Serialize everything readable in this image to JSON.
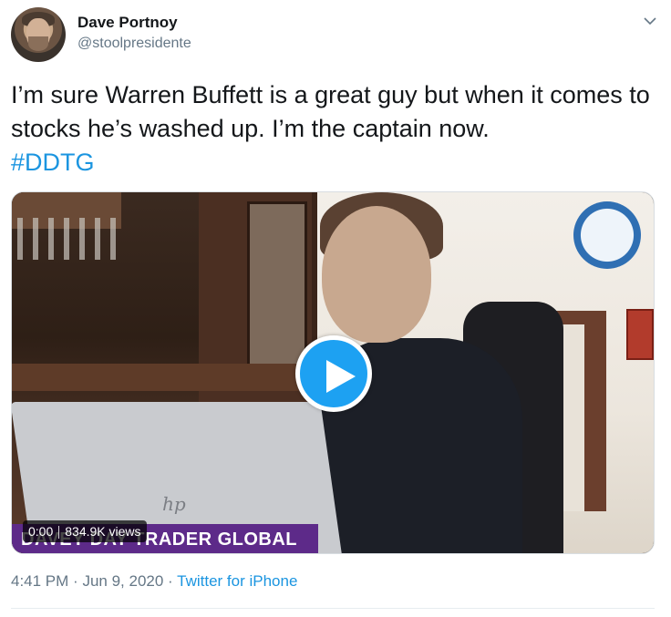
{
  "author": {
    "name": "Dave Portnoy",
    "handle": "@stoolpresidente"
  },
  "tweet": {
    "text": "I’m sure Warren Buffett is a great guy but when it comes to stocks he’s washed up. I’m the captain now.",
    "hashtag": "#DDTG"
  },
  "video": {
    "time": "0:00",
    "views": "834.9K views",
    "banner": "DAVEY DAY TRADER GLOBAL"
  },
  "footer": {
    "time": "4:41 PM",
    "separator": "·",
    "date": "Jun 9, 2020",
    "source": "Twitter for iPhone"
  },
  "colors": {
    "link": "#1b95e0",
    "play_button": "#1da1f2",
    "banner": "#5d2a89",
    "secondary_text": "#657786"
  },
  "icons": [
    "avatar",
    "chevron-down-icon",
    "play-icon"
  ]
}
